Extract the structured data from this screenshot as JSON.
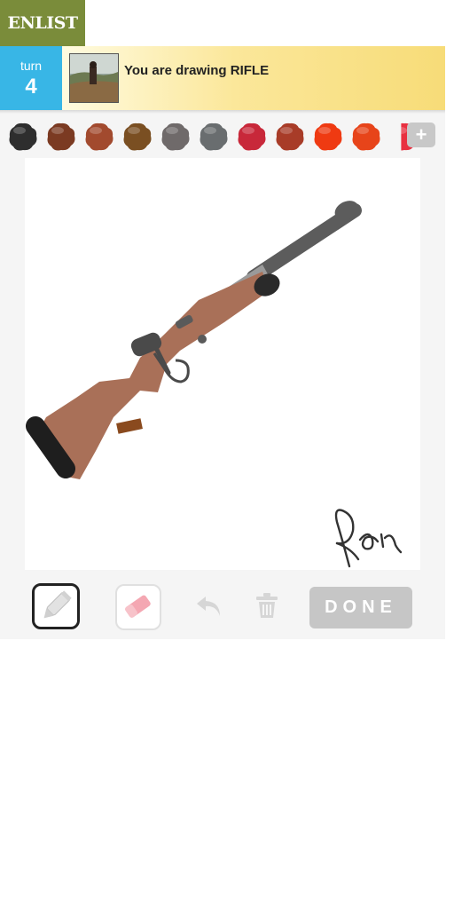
{
  "badge": {
    "text": "ENLIST"
  },
  "header": {
    "turn_label": "turn",
    "turn_number": "4",
    "prompt": "You are drawing RIFLE"
  },
  "palette": {
    "colors": [
      "#2e2e2e",
      "#7b3a22",
      "#a24a2e",
      "#7a4f22",
      "#6f6a6a",
      "#696d6f",
      "#c8283a",
      "#a83c28",
      "#ef3a12",
      "#e7441a",
      "#e83040"
    ],
    "more_button": "+"
  },
  "drawing": {
    "subject": "rifle",
    "signature": "signature"
  },
  "toolbar": {
    "pencil": "pencil-icon",
    "eraser": "eraser-icon",
    "undo": "undo-icon",
    "trash": "trash-icon",
    "done_label": "DONE"
  }
}
